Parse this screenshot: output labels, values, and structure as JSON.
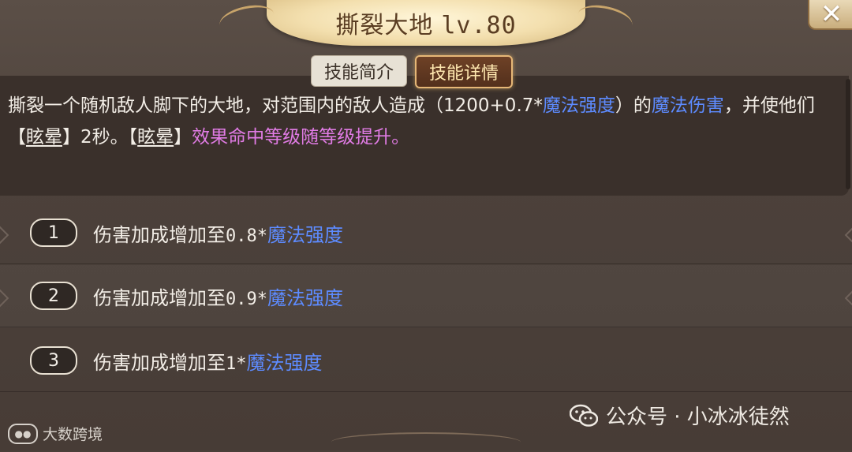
{
  "title": {
    "name": "撕裂大地",
    "level": "lv.80"
  },
  "tabs": [
    {
      "label": "技能简介",
      "active": false
    },
    {
      "label": "技能详情",
      "active": true
    }
  ],
  "description": {
    "p1": "撕裂一个随机敌人脚下的大地，对范围内的敌人造成（1200+0.7*",
    "kw1": "魔法强度",
    "p2": "）的",
    "kw2": "魔法伤害",
    "p3": "，并使他们【",
    "kw3": "眩晕",
    "p4": "】2秒。【",
    "kw4": "眩晕",
    "p5": "】",
    "kw5": "效果命中等级随等级提升。"
  },
  "upgrades": [
    {
      "level": "1",
      "prefix": "伤害加成增加至",
      "value": "0.8*",
      "stat": "魔法强度"
    },
    {
      "level": "2",
      "prefix": "伤害加成增加至",
      "value": "0.9*",
      "stat": "魔法强度"
    },
    {
      "level": "3",
      "prefix": "伤害加成增加至",
      "value": "1*",
      "stat": "魔法强度"
    }
  ],
  "watermark_left": "大数跨境",
  "watermark_right": "公众号 · 小冰冰徒然",
  "colors": {
    "keyword_blue": "#5d8bff",
    "keyword_pink": "#e07be4",
    "title_text": "#5a3d22"
  },
  "icons": [
    "close-icon",
    "wechat-icon"
  ]
}
